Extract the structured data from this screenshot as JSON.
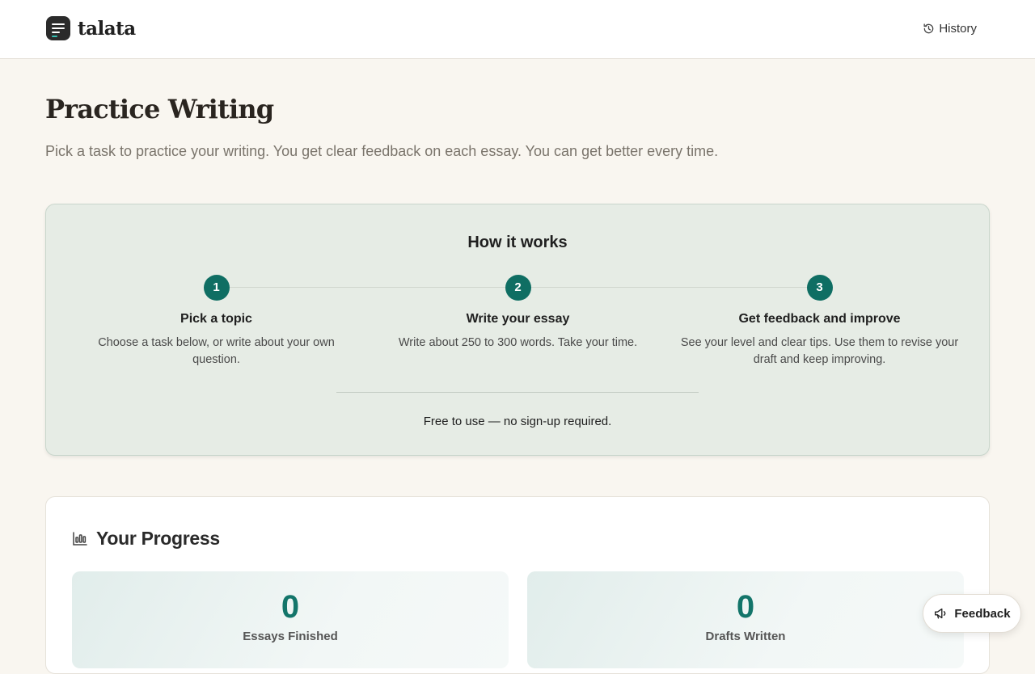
{
  "header": {
    "brand": "talata",
    "history_label": "History"
  },
  "main": {
    "title": "Practice Writing",
    "subtitle": "Pick a task to practice your writing. You get clear feedback on each essay. You can get better every time."
  },
  "how_it_works": {
    "title": "How it works",
    "steps": [
      {
        "number": "1",
        "title": "Pick a topic",
        "desc": "Choose a task below, or write about your own question."
      },
      {
        "number": "2",
        "title": "Write your essay",
        "desc": "Write about 250 to 300 words. Take your time."
      },
      {
        "number": "3",
        "title": "Get feedback and improve",
        "desc": "See your level and clear tips. Use them to revise your draft and keep improving."
      }
    ],
    "note": "Free to use — no sign-up required."
  },
  "progress": {
    "title": "Your Progress",
    "stats": [
      {
        "value": "0",
        "label": "Essays Finished"
      },
      {
        "value": "0",
        "label": "Drafts Written"
      }
    ]
  },
  "feedback": {
    "label": "Feedback"
  },
  "colors": {
    "accent": "#0f6e63",
    "background": "#f9f6f0",
    "card_green": "#e6ece5"
  }
}
